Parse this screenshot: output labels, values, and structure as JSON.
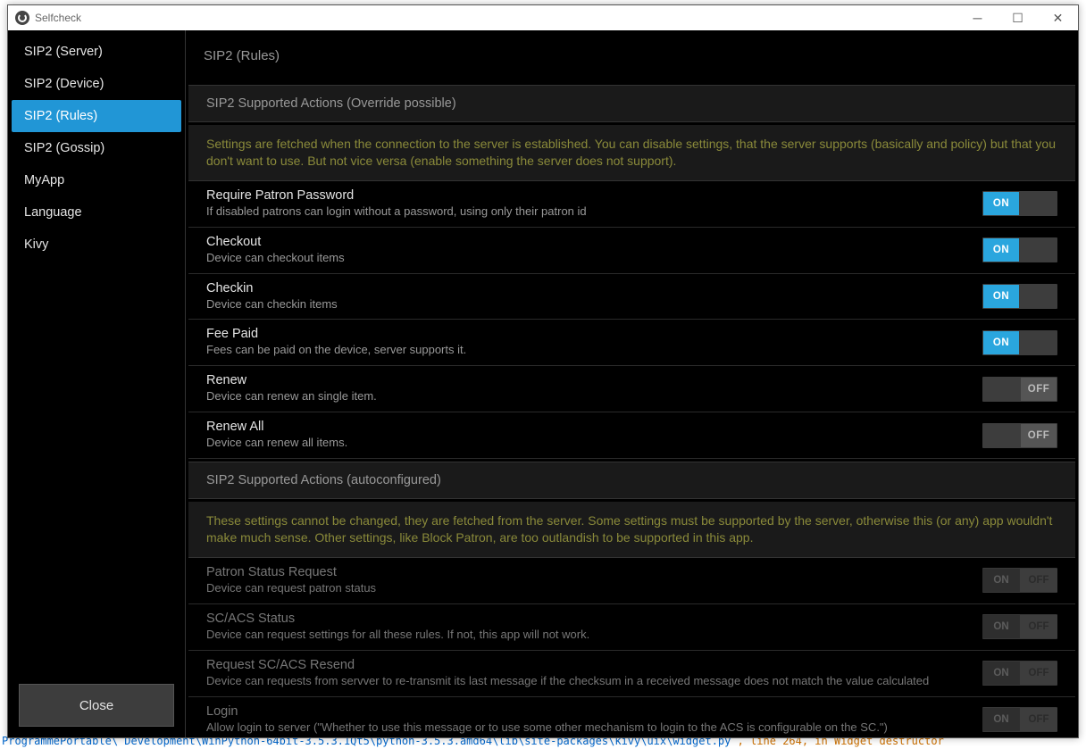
{
  "window": {
    "title": "Selfcheck",
    "close_label": "Close"
  },
  "sidebar": {
    "items": [
      {
        "label": "SIP2 (Server)",
        "key": "sidebar-item-sip2-server"
      },
      {
        "label": "SIP2 (Device)",
        "key": "sidebar-item-sip2-device"
      },
      {
        "label": "SIP2 (Rules)",
        "key": "sidebar-item-sip2-rules"
      },
      {
        "label": "SIP2 (Gossip)",
        "key": "sidebar-item-sip2-gossip"
      },
      {
        "label": "MyApp",
        "key": "sidebar-item-myapp"
      },
      {
        "label": "Language",
        "key": "sidebar-item-language"
      },
      {
        "label": "Kivy",
        "key": "sidebar-item-kivy"
      }
    ],
    "active_index": 2
  },
  "page": {
    "title": "SIP2 (Rules)",
    "toggle_on_text": "ON",
    "toggle_off_text": "OFF",
    "section1": {
      "header": "SIP2 Supported Actions (Override possible)",
      "info": "Settings are fetched when the connection to the server is established. You can disable settings, that the server supports (basically and policy) but that you don't want to use. But not vice versa (enable something the server does not support).",
      "rows": [
        {
          "label": "Require Patron Password",
          "desc": "If disabled patrons can login without a password, using only their patron id",
          "state": "on"
        },
        {
          "label": "Checkout",
          "desc": "Device can checkout items",
          "state": "on"
        },
        {
          "label": "Checkin",
          "desc": "Device can checkin items",
          "state": "on"
        },
        {
          "label": "Fee Paid",
          "desc": "Fees can be paid on the device, server supports it.",
          "state": "on"
        },
        {
          "label": "Renew",
          "desc": "Device can renew an single item.",
          "state": "off"
        },
        {
          "label": "Renew All",
          "desc": "Device can renew all items.",
          "state": "off"
        }
      ]
    },
    "section2": {
      "header": "SIP2 Supported Actions (autoconfigured)",
      "info": "These settings cannot be changed, they are fetched from the server. Some settings must be supported by the server, otherwise this (or any) app wouldn't make much sense. Other settings, like Block Patron, are too outlandish to be supported in this app.",
      "rows": [
        {
          "label": "Patron Status Request",
          "desc": "Device can request patron status"
        },
        {
          "label": "SC/ACS Status",
          "desc": "Device can request settings for all these rules. If not, this app will not work."
        },
        {
          "label": "Request SC/ACS Resend",
          "desc": "Device can requests from servver to re-transmit its last message if the checksum in a received message does not match the value calculated"
        },
        {
          "label": "Login",
          "desc": "Allow login to server (\"Whether to use this message or to use some other mechanism to login to the ACS is configurable on the SC.\")"
        }
      ]
    }
  },
  "console": {
    "path": "ProgrammePortable\\ Development\\WinPython-64bit-3.5.3.1Qt5\\python-3.5.3.amd64\\lib\\site-packages\\kivy\\uix\\widget.py",
    "rest": " , line 264, in   Widget destructor"
  }
}
